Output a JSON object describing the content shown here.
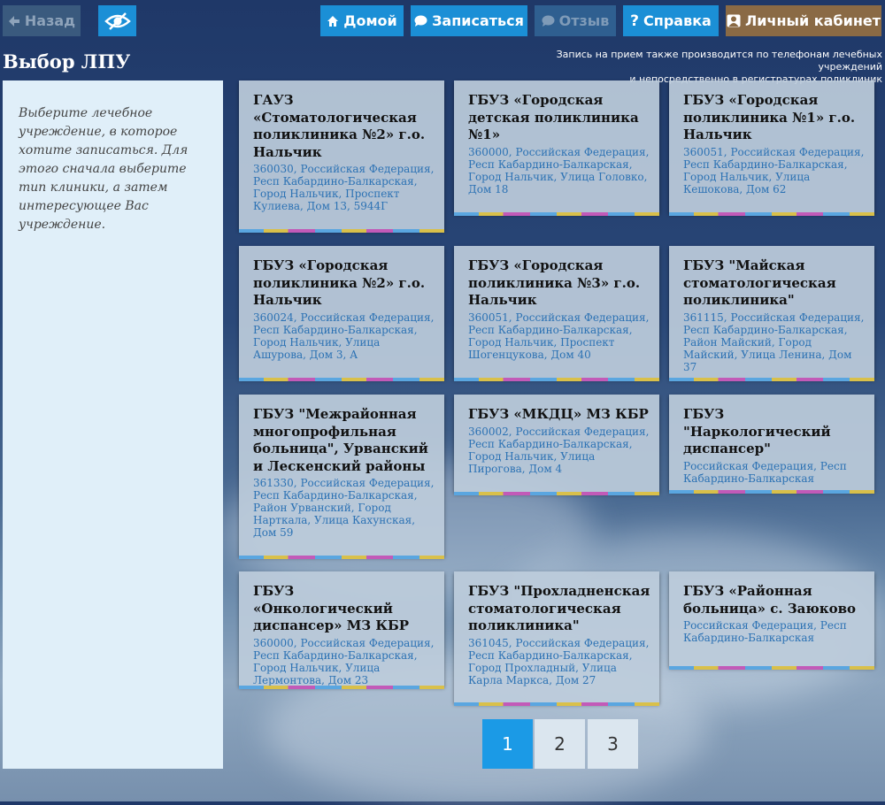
{
  "toolbar": {
    "back_label": "Назад",
    "home_label": "Домой",
    "signup_label": "Записаться",
    "review_label": "Отзыв",
    "help_label": "Справка",
    "cabinet_label": "Личный кабинет"
  },
  "page": {
    "title": "Выбор ЛПУ",
    "notice_line1": "Запись на прием также производится по телефонам лечебных учреждений",
    "notice_line2": "и непосредственно в регистратурах поликлиник"
  },
  "sidebar": {
    "text": "Выберите лечебное учреждение, в которое хотите записаться. Для этого сначала выберите тип клиники, а затем интересующее Вас учреждение."
  },
  "clinics": [
    {
      "name": "ГАУЗ «Стоматологическая поликлиника №2» г.о. Нальчик",
      "address": "360030, Российская Федерация, Респ Кабардино-Балкарская, Город Нальчик, Проспект Кулиева, Дом 13, 5944Г"
    },
    {
      "name": "ГБУЗ «Городская детская поликлиника №1»",
      "address": "360000, Российская Федерация, Респ Кабардино-Балкарская, Город Нальчик, Улица Головко, Дом 18"
    },
    {
      "name": "ГБУЗ «Городская поликлиника №1» г.о. Нальчик",
      "address": "360051, Российская Федерация, Респ Кабардино-Балкарская, Город Нальчик, Улица Кешокова, Дом 62"
    },
    {
      "name": "ГБУЗ «Городская поликлиника №2» г.о. Нальчик",
      "address": "360024, Российская Федерация, Респ Кабардино-Балкарская, Город Нальчик, Улица Ашурова, Дом 3, А"
    },
    {
      "name": "ГБУЗ «Городская поликлиника №3» г.о. Нальчик",
      "address": "360051, Российская Федерация, Респ Кабардино-Балкарская, Город Нальчик, Проспект Шогенцукова, Дом 40"
    },
    {
      "name": "ГБУЗ \"Майская стоматологическая поликлиника\"",
      "address": "361115, Российская Федерация, Респ Кабардино-Балкарская, Район Майский, Город Майский, Улица Ленина, Дом 37"
    },
    {
      "name": "ГБУЗ \"Межрайонная многопрофильная больница\", Урванский и Лескенский районы",
      "address": "361330, Российская Федерация, Респ Кабардино-Балкарская, Район Урванский, Город Нарткала, Улица Кахунская, Дом 59"
    },
    {
      "name": "ГБУЗ «МКДЦ» МЗ КБР",
      "address": "360002, Российская Федерация, Респ Кабардино-Балкарская, Город Нальчик, Улица Пирогова, Дом 4"
    },
    {
      "name": "ГБУЗ \"Наркологический диспансер\"",
      "address": "Российская Федерация, Респ Кабардино-Балкарская"
    },
    {
      "name": "ГБУЗ «Онкологический диспансер» МЗ КБР",
      "address": "360000, Российская Федерация, Респ Кабардино-Балкарская, Город Нальчик, Улица Лермонтова, Дом 23"
    },
    {
      "name": "ГБУЗ \"Прохладненская стоматологическая поликлиника\"",
      "address": "361045, Российская Федерация, Респ Кабардино-Балкарская, Город Прохладный, Улица Карла Маркса, Дом 27"
    },
    {
      "name": "ГБУЗ «Районная больница» с. Заюково",
      "address": "Российская Федерация, Респ Кабардино-Балкарская"
    }
  ],
  "pagination": {
    "pages": [
      "1",
      "2",
      "3"
    ],
    "current": "1"
  },
  "colors": {
    "accent": "#1b8fd6",
    "cabinet": "#8a6a45",
    "sidebar": "#e0eff9",
    "link": "#2c72b4"
  },
  "icons": [
    "arrow-left-icon",
    "eye-slash-icon",
    "home-icon",
    "speech-bubble-icon",
    "question-icon",
    "user-icon"
  ]
}
